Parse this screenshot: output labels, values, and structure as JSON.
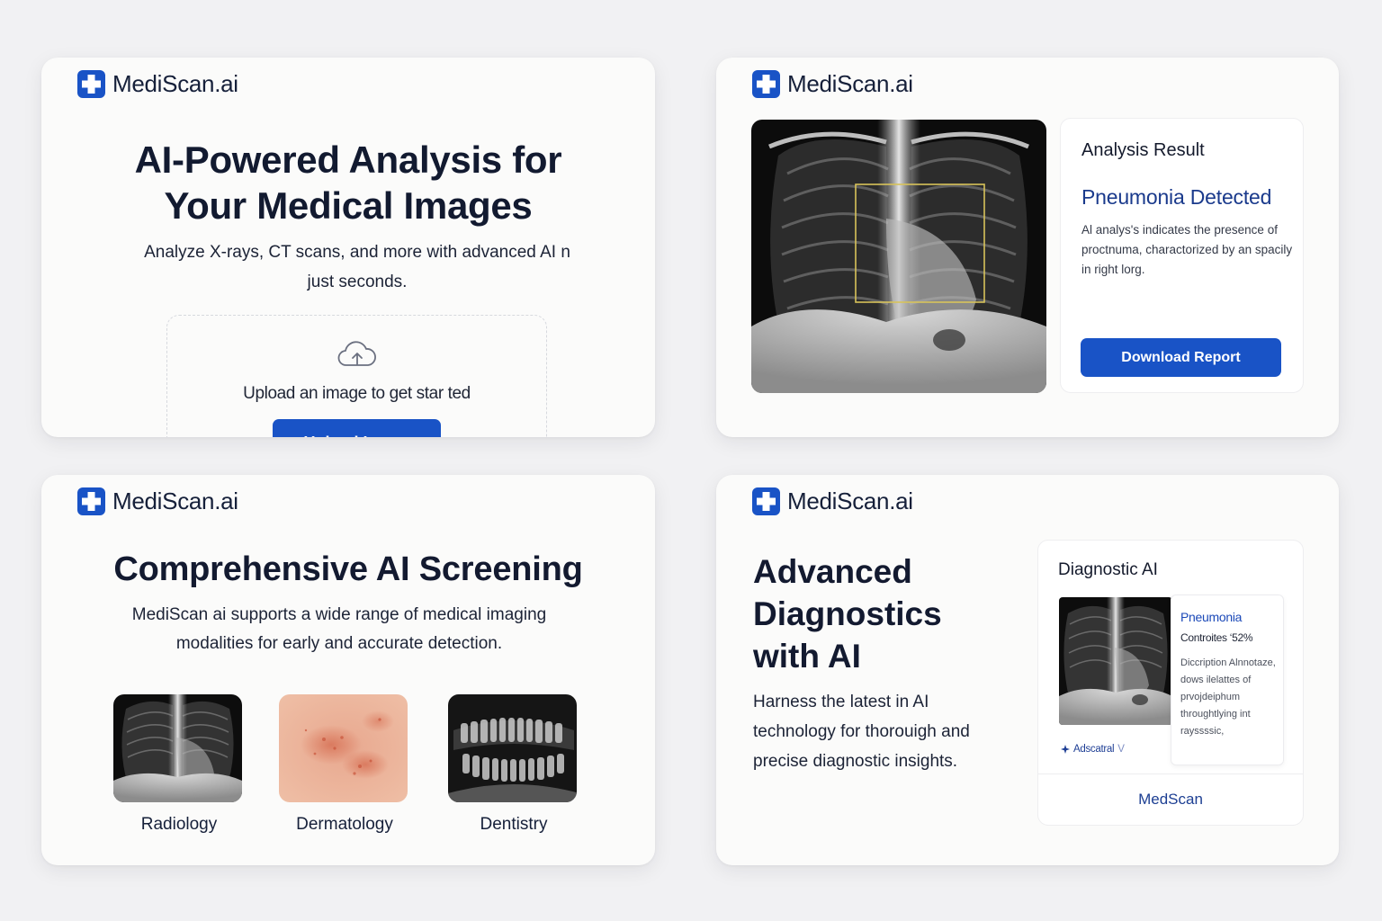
{
  "brand": {
    "name": "MediScan.ai",
    "accent_color": "#1953c6",
    "icon": "medical-cross-icon"
  },
  "upload_card": {
    "title_line1": "AI-Powered Analysis for",
    "title_line2": "Your Medical Images",
    "subtitle_line1": "Analyze X-rays, CT scans, and more with advanced AI n",
    "subtitle_line2": "just seconds.",
    "upload_prompt": "Upload an image to get star ted",
    "upload_button": "Upload Image",
    "icon": "cloud-upload-icon"
  },
  "result_card": {
    "heading": "Analysis Result",
    "finding": "Pneumonia Detected",
    "description": "Al analys's indicates the presence of proctnuma, charactorized by an spacily in right lorg.",
    "download_button": "Download Report",
    "highlight_color": "#d8c35a"
  },
  "screening_card": {
    "title": "Comprehensive AI Screening",
    "subtitle_line1": "MediScan ai supports a wide range of medical imaging",
    "subtitle_line2": "modalities for early and accurate detection.",
    "modalities": [
      {
        "label": "Radiology"
      },
      {
        "label": "Dermatology"
      },
      {
        "label": "Dentistry"
      }
    ]
  },
  "diagnostics_card": {
    "title_line1": "Advanced",
    "title_line2": "Diagnostics",
    "title_line3": "with AI",
    "subtitle_line1": "Harness the latest in AI",
    "subtitle_line2": "technology for thorouigh and",
    "subtitle_line3": "precise diagnostic insights.",
    "panel": {
      "heading": "Diagnostic AI",
      "result_title": "Pneumonia",
      "result_confidence": "Controites ‘52%",
      "description": "Diccription Alnnotaze, dows ilelattes of prvojdeiphum throughtlying int rayssssic,",
      "badge": "Adscatral",
      "badge_suffix": "V",
      "footer": "MedScan"
    }
  }
}
